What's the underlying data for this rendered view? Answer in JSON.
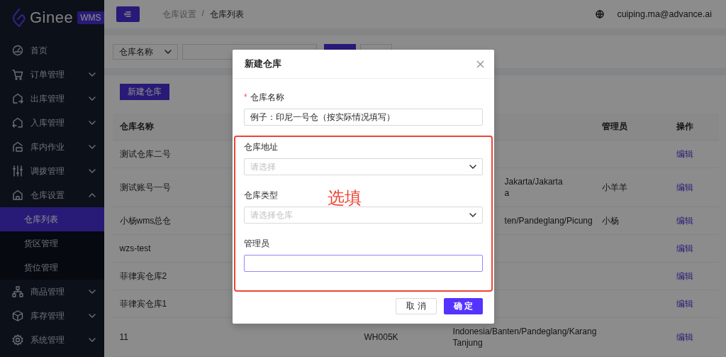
{
  "sidebar": {
    "logo": {
      "name": "Ginee",
      "badge": "WMS"
    },
    "items": [
      {
        "label": "首页"
      },
      {
        "label": "订单管理",
        "expanded": false
      },
      {
        "label": "出库管理",
        "expanded": false
      },
      {
        "label": "入库管理",
        "expanded": false
      },
      {
        "label": "库内作业",
        "expanded": false
      },
      {
        "label": "调拨管理",
        "expanded": false
      },
      {
        "label": "仓库设置",
        "expanded": true,
        "children": [
          {
            "label": "仓库列表",
            "selected": true
          },
          {
            "label": "货区管理",
            "selected": false
          },
          {
            "label": "货位管理",
            "selected": false
          }
        ]
      },
      {
        "label": "商品管理",
        "expanded": false
      },
      {
        "label": "库存管理",
        "expanded": false
      },
      {
        "label": "系统管理",
        "expanded": false
      }
    ]
  },
  "header": {
    "breadcrumb": [
      "仓库设置",
      "仓库列表"
    ],
    "breadcrumb_separator": "/",
    "user": "cuiping.ma@advance.ai"
  },
  "filter": {
    "field_select": "仓库名称"
  },
  "toolbar": {
    "create_button": "新建仓库"
  },
  "table": {
    "columns": [
      "仓库名称",
      null,
      null,
      "管理员",
      "操作"
    ],
    "rows": [
      {
        "name": "测试仓库二号",
        "cut": false,
        "action": "编辑"
      },
      {
        "name": "测试账号一号",
        "address": "Jakarta/Jakarta\na",
        "cut": true,
        "manager": "小羊羊",
        "action": "编辑"
      },
      {
        "name": "小杨wms总仓",
        "address": "ten/Pandeglang/Picung",
        "cut": true,
        "manager": "小杨",
        "action": "编辑"
      },
      {
        "name": "wzs-test",
        "cut": false,
        "action": "编辑"
      },
      {
        "name": "菲律宾仓库2",
        "cut": false,
        "action": "编辑"
      },
      {
        "name": "菲律宾仓库1",
        "cut": false,
        "action": "编辑"
      },
      {
        "name": "11",
        "code": "WH005K",
        "address": "Indonesia/Banten/Pandeglang/Karang Tanjung",
        "cut": false,
        "action": "编辑"
      }
    ]
  },
  "modal": {
    "title": "新建仓库",
    "required_mark": "*",
    "fields": [
      {
        "kind": "input",
        "label": "仓库名称",
        "required": true,
        "value": "例子：印尼一号仓（按实际情况填写）",
        "focused": false
      },
      {
        "kind": "select",
        "label": "仓库地址",
        "required": false,
        "placeholder": "请选择",
        "focused": false
      },
      {
        "kind": "select",
        "label": "仓库类型",
        "required": false,
        "placeholder": "请选择仓库",
        "focused": false
      },
      {
        "kind": "input",
        "label": "管理员",
        "required": false,
        "focused": true
      }
    ],
    "annotation": "选填",
    "buttons": [
      {
        "label": "取 消",
        "kind": "secondary"
      },
      {
        "label": "确 定",
        "kind": "primary"
      }
    ]
  }
}
